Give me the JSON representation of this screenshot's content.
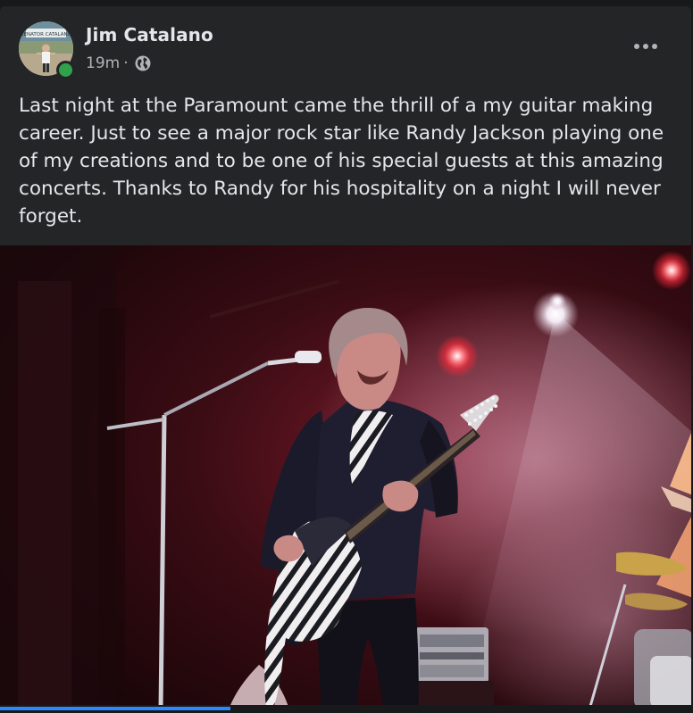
{
  "post": {
    "author": "Jim Catalano",
    "timestamp": "19m",
    "separator": "·",
    "audience_icon": "globe-icon",
    "status_color": "#31a24c",
    "caption": "Last night at the Paramount came the thrill of a my guitar making career. Just to see a major rock star like Randy Jackson playing one of my creations and to be one of his special guests at this amazing concerts. Thanks to Randy for his hospitality on a night I will never forget.",
    "avatar_sign": "SENATOR CATALANO",
    "more_icon": "more-options-icon"
  },
  "photo": {
    "subject": "Randy Jackson playing a 12-string zebra-striped guitar on stage",
    "background_color": "#2a0b10",
    "stage_light_color": "#ff2a3a"
  }
}
